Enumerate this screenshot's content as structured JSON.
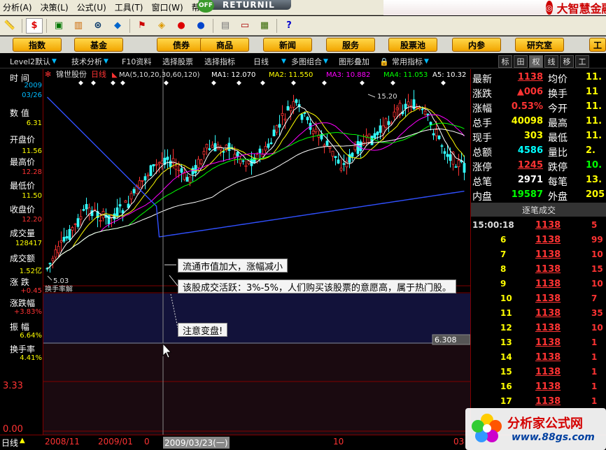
{
  "menu": {
    "items": [
      "分析(A)",
      "决策(L)",
      "公式(U)",
      "工具(T)",
      "窗口(W)",
      "帮"
    ],
    "brand_title": "大智慧金融终端",
    "returnil_text": "RETURNIL",
    "returnil_off": "OFF"
  },
  "funcbar": {
    "buttons": [
      "指数",
      "基金",
      "债券",
      "商品",
      "新闻",
      "服务",
      "股票池",
      "内参",
      "研究室"
    ],
    "extra": "工"
  },
  "chartbar": {
    "items": [
      "Level2默认",
      "技术分析",
      "F10资料",
      "选择股票",
      "选择指标",
      "日线",
      "多图组合",
      "图形叠加",
      "常用指标"
    ],
    "right_tabs": [
      "标",
      "田",
      "权",
      "线",
      "移",
      "工"
    ]
  },
  "chart_header": {
    "stock_name": "锦世股份",
    "period": "日线",
    "ma_params": "MA(5,10,20,30,60,120)",
    "ma1": "MA1: 12.070",
    "ma2": "MA2: 11.550",
    "ma3": "MA3: 10.882",
    "ma4": "MA4: 11.053",
    "ma5": "A5: 10.32",
    "high_label": "15.20",
    "low_label": "5.03",
    "indicator_label": "换手率解",
    "cursor_value": "6.308",
    "y_top_label": "3.33",
    "y_bottom_label": "0.00"
  },
  "left_panel": [
    {
      "label": "时 间",
      "value": "2009"
    },
    {
      "label": "",
      "value": "03/26"
    },
    {
      "label": "数 值",
      "value": "6.31"
    },
    {
      "label": "开盘价",
      "value": "11.56"
    },
    {
      "label": "最高价",
      "value": "12.28"
    },
    {
      "label": "最低价",
      "value": "11.50"
    },
    {
      "label": "收盘价",
      "value": "12.20"
    },
    {
      "label": "成交量",
      "value": "128417"
    },
    {
      "label": "成交额",
      "value": "1.52亿"
    },
    {
      "label": "涨 跌",
      "value": "+0.45"
    },
    {
      "label": "涨跌幅",
      "value": "+3.83%"
    },
    {
      "label": "振 幅",
      "value": "6.64%"
    },
    {
      "label": "换手率",
      "value": "4.41%"
    }
  ],
  "quote": [
    {
      "l1": "最新",
      "v1": "1138",
      "l2": "均价",
      "v2": "11."
    },
    {
      "l1": "涨跌",
      "v1": "▲006",
      "l2": "换手",
      "v2": "11"
    },
    {
      "l1": "涨幅",
      "v1": "0.53%",
      "l2": "今开",
      "v2": "11."
    },
    {
      "l1": "总手",
      "v1": "40098",
      "l2": "最高",
      "v2": "11."
    },
    {
      "l1": "现手",
      "v1": "303",
      "l2": "最低",
      "v2": "11."
    },
    {
      "l1": "总额",
      "v1": "4586",
      "l2": "量比",
      "v2": "2."
    },
    {
      "l1": "涨停",
      "v1": "1245",
      "l2": "跌停",
      "v2": "10."
    },
    {
      "l1": "总笔",
      "v1": "2971",
      "l2": "每笔",
      "v2": "13."
    },
    {
      "l1": "内盘",
      "v1": "19587",
      "l2": "外盘",
      "v2": "205"
    }
  ],
  "trades": {
    "title": "逐笔成交",
    "rows": [
      {
        "time": "15:00:18",
        "price": "1138",
        "vol": "5"
      },
      {
        "time": "6",
        "price": "1138",
        "vol": "99"
      },
      {
        "time": "7",
        "price": "1138",
        "vol": "10"
      },
      {
        "time": "8",
        "price": "1138",
        "vol": "15"
      },
      {
        "time": "9",
        "price": "1138",
        "vol": "10"
      },
      {
        "time": "10",
        "price": "1138",
        "vol": "7"
      },
      {
        "time": "11",
        "price": "1138",
        "vol": "35"
      },
      {
        "time": "12",
        "price": "1138",
        "vol": "10"
      },
      {
        "time": "13",
        "price": "1138",
        "vol": "1"
      },
      {
        "time": "14",
        "price": "1138",
        "vol": "1"
      },
      {
        "time": "15",
        "price": "1138",
        "vol": "1"
      },
      {
        "time": "16",
        "price": "1138",
        "vol": "1"
      },
      {
        "time": "17",
        "price": "1138",
        "vol": "1"
      }
    ]
  },
  "annotations": {
    "a1": "流通市值加大，涨幅减小",
    "a2": "该股成交活跃：3%-5%，人们购买该股票的意愿高，属于热门股。",
    "a3": "注意变盘!"
  },
  "bottom": {
    "period_label": "日线",
    "dates": [
      "2008/11",
      "2009/01",
      "0",
      "2009/03/23(一)",
      "10",
      "03"
    ]
  },
  "watermark": {
    "title": "分析家公式网",
    "url": "www.88gs.com"
  },
  "colors": {
    "up": "#ff3333",
    "down": "#33ffff",
    "ma1": "#ffffff",
    "ma2": "#ffff00",
    "ma3": "#ff00ff",
    "ma4": "#00ff00",
    "ma5": "#ffffff",
    "ma6": "#3050ff"
  }
}
